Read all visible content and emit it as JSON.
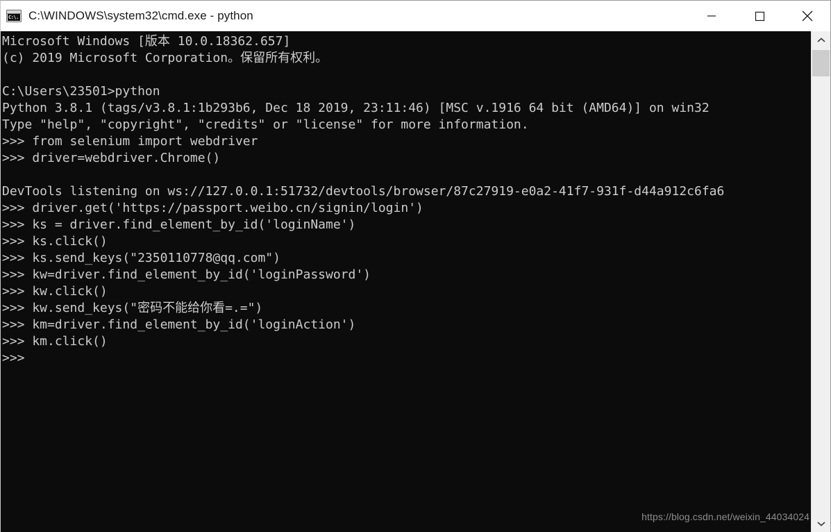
{
  "window": {
    "title": "C:\\WINDOWS\\system32\\cmd.exe - python",
    "icon_name": "cmd-console-icon",
    "icon_glyph": "C:\\.",
    "titlebar_bg": "#ffffff",
    "console_bg": "#0c0c0c",
    "console_fg": "#cccccc"
  },
  "titlebar_buttons": {
    "minimize_label": "Minimize",
    "maximize_label": "Maximize",
    "close_label": "Close"
  },
  "console": {
    "lines": [
      "Microsoft Windows [版本 10.0.18362.657]",
      "(c) 2019 Microsoft Corporation。保留所有权利。",
      "",
      "C:\\Users\\23501>python",
      "Python 3.8.1 (tags/v3.8.1:1b293b6, Dec 18 2019, 23:11:46) [MSC v.1916 64 bit (AMD64)] on win32",
      "Type \"help\", \"copyright\", \"credits\" or \"license\" for more information.",
      ">>> from selenium import webdriver",
      ">>> driver=webdriver.Chrome()",
      "",
      "DevTools listening on ws://127.0.0.1:51732/devtools/browser/87c27919-e0a2-41f7-931f-d44a912c6fa6",
      ">>> driver.get('https://passport.weibo.cn/signin/login')",
      ">>> ks = driver.find_element_by_id('loginName')",
      ">>> ks.click()",
      ">>> ks.send_keys(\"2350110778@qq.com\")",
      ">>> kw=driver.find_element_by_id('loginPassword')",
      ">>> kw.click()",
      ">>> kw.send_keys(\"密码不能给你看=.=\")",
      ">>> km=driver.find_element_by_id('loginAction')",
      ">>> km.click()",
      ">>>"
    ]
  },
  "watermark": {
    "text": "https://blog.csdn.net/weixin_44034024"
  },
  "scrollbar": {
    "up_arrow_name": "scroll-up-arrow",
    "down_arrow_name": "scroll-down-arrow",
    "thumb_name": "scrollbar-thumb"
  }
}
